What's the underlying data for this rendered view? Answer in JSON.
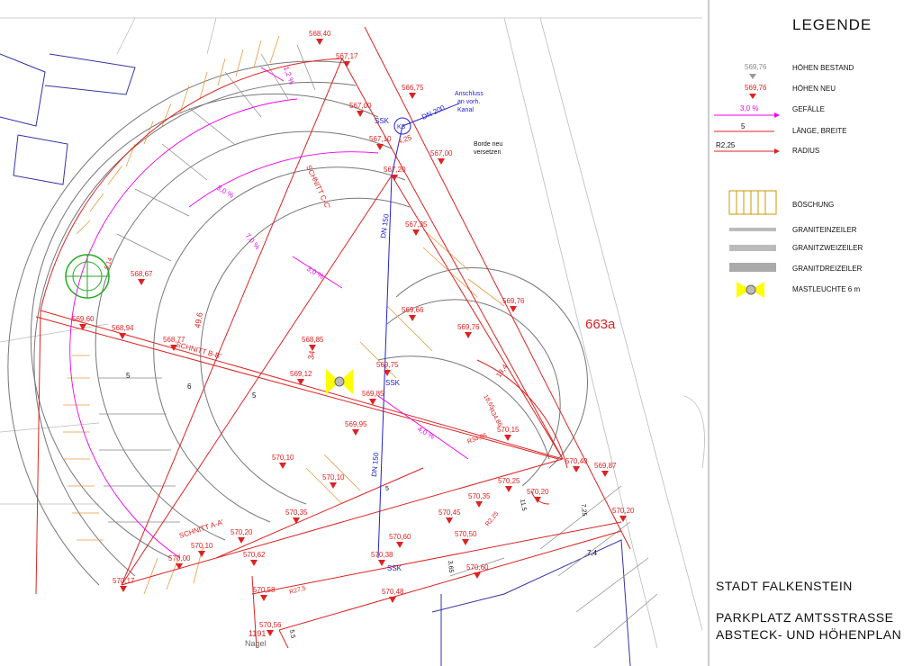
{
  "legend": {
    "title": "LEGENDE",
    "hoehen_bestand_value": "569,76",
    "hoehen_bestand_label": "HÖHEN BESTAND",
    "hoehen_neu_value": "569,76",
    "hoehen_neu_label": "HÖHEN NEU",
    "gefaelle_value": "3,0 %",
    "gefaelle_label": "GEFÄLLE",
    "laenge_value": "5",
    "laenge_label": "LÄNGE, BREITE",
    "radius_value": "R2,25",
    "radius_label": "RADIUS",
    "boeschung_label": "BÖSCHUNG",
    "graniteinzeiler_label": "GRANITEINZEILER",
    "granitzweizeiler_label": "GRANITZWEIZEILER",
    "granitdreizeiler_label": "GRANITDREIZEILER",
    "mastleuchte_label": "MASTLEUCHTE 6 m"
  },
  "title_block": {
    "city": "STADT FALKENSTEIN",
    "line1": "PARKPLATZ  AMTSSTRASSE",
    "line2": "ABSTECK- UND HÖHENPLAN"
  },
  "plan": {
    "parcel": "663a",
    "owner": "Nagel",
    "house_number": "1191",
    "anschluss": [
      "Anschluss",
      "an vorh.",
      "Kanal"
    ],
    "borde": [
      "Borde neu",
      "versetzen"
    ],
    "ks": "KS",
    "ssk": "SSK",
    "dn200": "DN 200",
    "dn150": "DN 150",
    "schnitt_aa": "SCHNITT A-A'",
    "schnitt_bb": "SCHNITT B-B'",
    "schnitt_cc": "SCHNITT C-C'",
    "slopes": [
      "3,0 %",
      "7,0 %",
      "3,0 %",
      "4,0 %",
      "1,2 %"
    ],
    "dimensions": [
      "49,6",
      "34",
      "5",
      "6",
      "5",
      "18,4",
      "18,65",
      "11,5",
      "7,25",
      "7,4",
      "3,65",
      "R27,5",
      "R34,86",
      "R34,85",
      "R2,25",
      "4,25",
      "5,5",
      "5",
      "5,14"
    ],
    "heights": [
      {
        "label": "568,40"
      },
      {
        "label": "567,17"
      },
      {
        "label": "566,75"
      },
      {
        "label": "567,00"
      },
      {
        "label": "567,10"
      },
      {
        "label": "567,00"
      },
      {
        "label": "567,20"
      },
      {
        "label": "567,35"
      },
      {
        "label": "568,67"
      },
      {
        "label": "569,60"
      },
      {
        "label": "568,94"
      },
      {
        "label": "568,77"
      },
      {
        "label": "568,85"
      },
      {
        "label": "569,12"
      },
      {
        "label": "569,66"
      },
      {
        "label": "569,76"
      },
      {
        "label": "569,76"
      },
      {
        "label": "569,75"
      },
      {
        "label": "569,85"
      },
      {
        "label": "569,95"
      },
      {
        "label": "570,15"
      },
      {
        "label": "570,10"
      },
      {
        "label": "570,10"
      },
      {
        "label": "570,40"
      },
      {
        "label": "569,87"
      },
      {
        "label": "570,25"
      },
      {
        "label": "570,20"
      },
      {
        "label": "570,35"
      },
      {
        "label": "570,35"
      },
      {
        "label": "570,45"
      },
      {
        "label": "570,50"
      },
      {
        "label": "570,60"
      },
      {
        "label": "570,60"
      },
      {
        "label": "570,20"
      },
      {
        "label": "570,20"
      },
      {
        "label": "570,10"
      },
      {
        "label": "570,00"
      },
      {
        "label": "570,62"
      },
      {
        "label": "570,38"
      },
      {
        "label": "570,17"
      },
      {
        "label": "570,58"
      },
      {
        "label": "570,48"
      },
      {
        "label": "570,56"
      }
    ]
  }
}
